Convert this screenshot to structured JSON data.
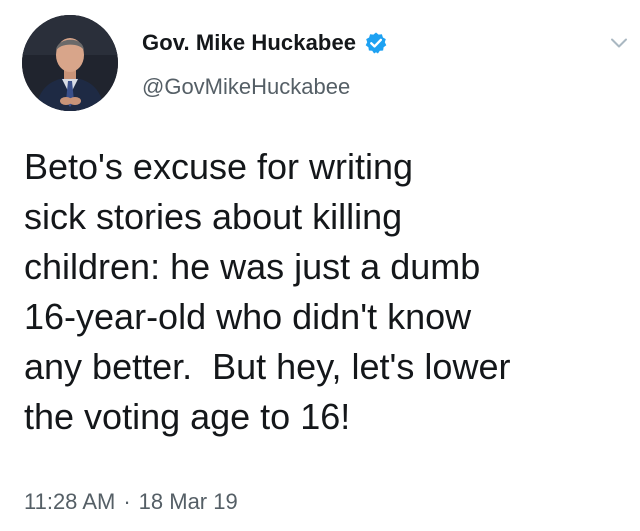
{
  "user": {
    "display_name": "Gov. Mike Huckabee",
    "handle": "@GovMikeHuckabee",
    "verified": true,
    "verified_color": "#1da1f2",
    "avatar_icon": "profile-photo"
  },
  "tweet": {
    "lines": [
      "Beto's excuse for writing",
      "sick stories about killing",
      "children: he was just a dumb",
      "16-year-old who didn't know",
      "any better.  But hey, let's lower",
      "the voting age to 16!"
    ]
  },
  "meta": {
    "time": "11:28 AM",
    "separator": "·",
    "date": "18 Mar 19"
  },
  "icons": {
    "menu": "chevron-down-icon",
    "verified": "verified-badge-icon"
  }
}
